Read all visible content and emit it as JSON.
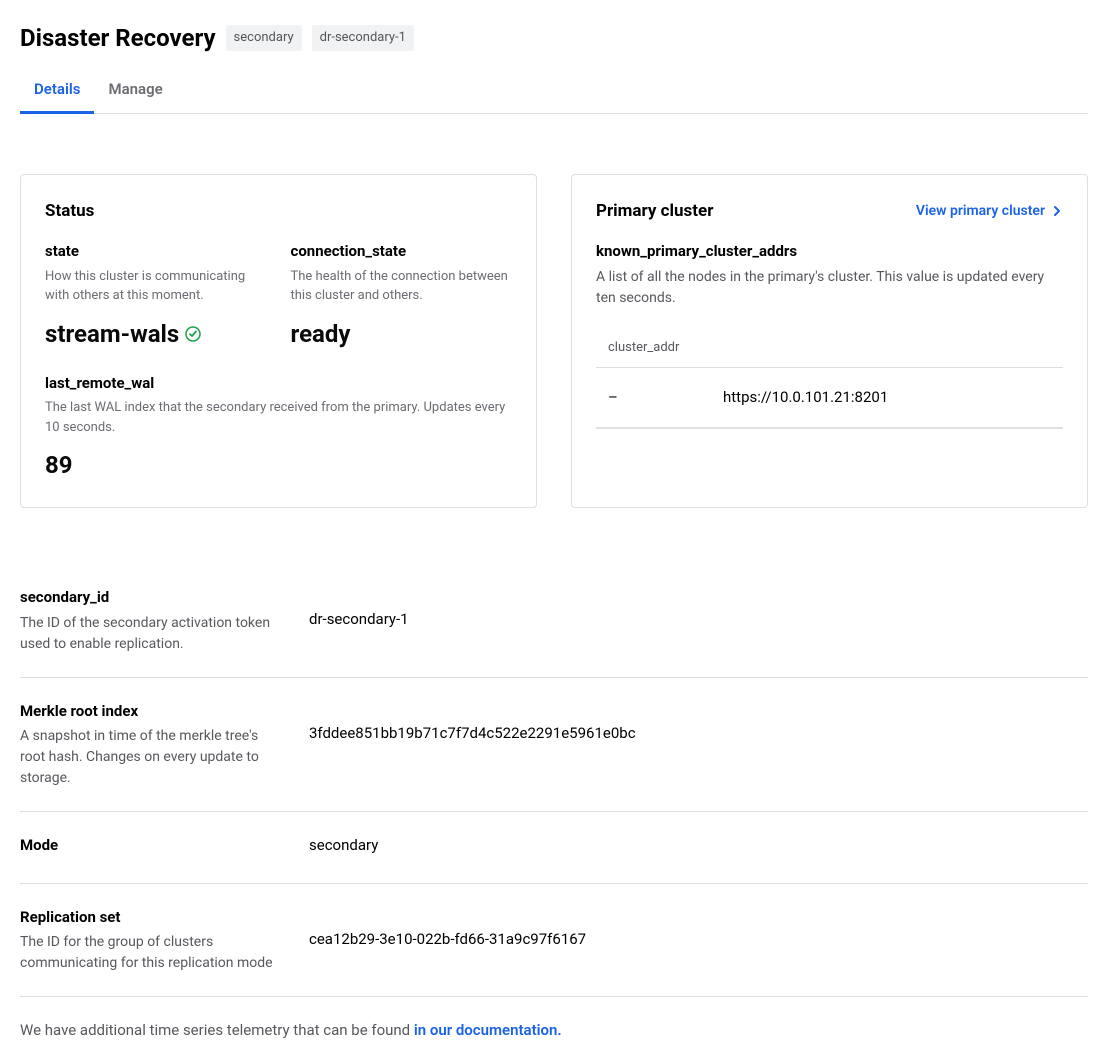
{
  "header": {
    "title": "Disaster Recovery",
    "badges": [
      "secondary",
      "dr-secondary-1"
    ]
  },
  "tabs": {
    "details": "Details",
    "manage": "Manage"
  },
  "status": {
    "title": "Status",
    "state": {
      "label": "state",
      "desc": "How this cluster is communicating with others at this moment.",
      "value": "stream-wals"
    },
    "connection_state": {
      "label": "connection_state",
      "desc": "The health of the connection between this cluster and others.",
      "value": "ready"
    },
    "last_remote_wal": {
      "label": "last_remote_wal",
      "desc": "The last WAL index that the secondary received from the primary. Updates every 10 seconds.",
      "value": "89"
    }
  },
  "primary_cluster": {
    "title": "Primary cluster",
    "action": "View primary cluster",
    "known_addrs_label": "known_primary_cluster_addrs",
    "known_addrs_desc": "A list of all the nodes in the primary's cluster. This value is updated every ten seconds.",
    "table_header": "cluster_addr",
    "rows": [
      {
        "dash": "–",
        "addr": "https://10.0.101.21:8201"
      }
    ]
  },
  "details": [
    {
      "label": "secondary_id",
      "desc": "The ID of the secondary activation token used to enable replication.",
      "value": "dr-secondary-1"
    },
    {
      "label": "Merkle root index",
      "desc": "A snapshot in time of the merkle tree's root hash. Changes on every update to storage.",
      "value": "3fddee851bb19b71c7f7d4c522e2291e5961e0bc"
    },
    {
      "label": "Mode",
      "desc": "",
      "value": "secondary"
    },
    {
      "label": "Replication set",
      "desc": "The ID for the group of clusters communicating for this replication mode",
      "value": "cea12b29-3e10-022b-fd66-31a9c97f6167"
    }
  ],
  "footer": {
    "text": "We have additional time series telemetry that can be found ",
    "link": "in our documentation."
  }
}
